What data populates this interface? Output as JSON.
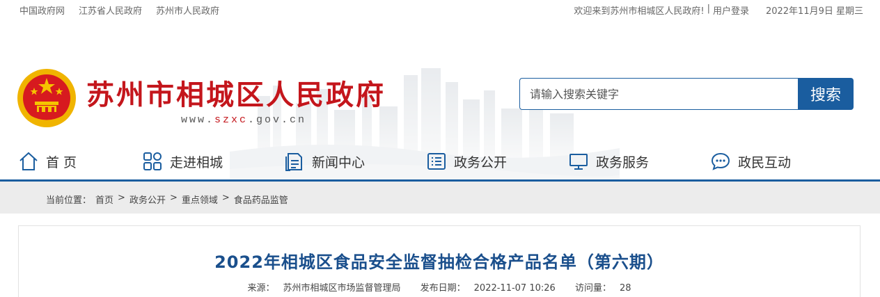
{
  "topbar": {
    "links": [
      "中国政府网",
      "江苏省人民政府",
      "苏州市人民政府"
    ],
    "welcome": "欢迎来到苏州市相城区人民政府!",
    "divider": "|",
    "login": "用户登录",
    "date": "2022年11月9日 星期三"
  },
  "header": {
    "title": "苏州市相城区人民政府",
    "url_prefix": "www.",
    "url_highlight": "szxc",
    "url_suffix": ".gov.cn"
  },
  "search": {
    "placeholder": "请输入搜索关键字",
    "button": "搜索"
  },
  "nav": {
    "items": [
      {
        "label": "首 页",
        "icon": "home-icon"
      },
      {
        "label": "走进相城",
        "icon": "grid-icon"
      },
      {
        "label": "新闻中心",
        "icon": "document-icon"
      },
      {
        "label": "政务公开",
        "icon": "list-icon"
      },
      {
        "label": "政务服务",
        "icon": "monitor-icon"
      },
      {
        "label": "政民互动",
        "icon": "chat-icon"
      }
    ]
  },
  "breadcrumb": {
    "prefix": "当前位置：",
    "items": [
      "首页",
      "政务公开",
      "重点领域",
      "食品药品监管"
    ],
    "separator": ">"
  },
  "article": {
    "title": "2022年相城区食品安全监督抽检合格产品名单（第六期）",
    "source_label": "来源：",
    "source": "苏州市相城区市场监督管理局",
    "date_label": "发布日期：",
    "date": "2022-11-07 10:26",
    "views_label": "访问量：",
    "views": "28"
  },
  "colors": {
    "brand_red": "#c4161c",
    "brand_blue": "#1a5d9f",
    "title_blue": "#1a4f8c"
  }
}
